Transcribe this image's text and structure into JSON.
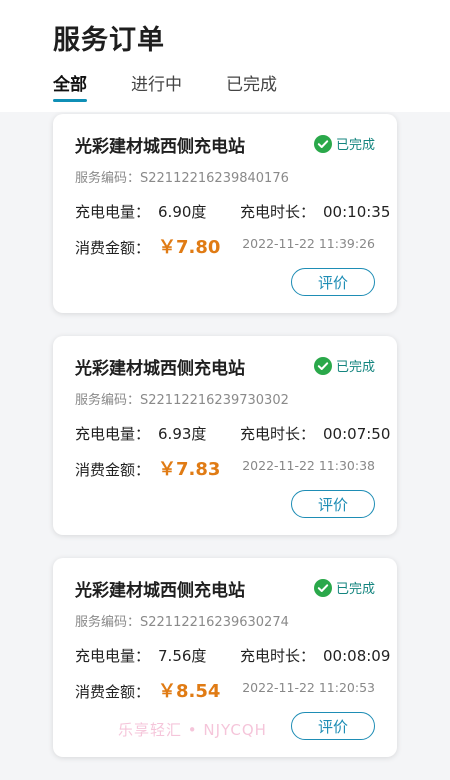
{
  "page": {
    "title": "服务订单"
  },
  "tabs": [
    {
      "label": "全部",
      "active": true
    },
    {
      "label": "进行中",
      "active": false
    },
    {
      "label": "已完成",
      "active": false
    }
  ],
  "colors": {
    "accent": "#0f8fb6",
    "amount": "#e07b14",
    "status": "#14857f"
  },
  "orders": [
    {
      "station": "光彩建材城西侧充电站",
      "status": "已完成",
      "code_label": "服务编码：",
      "code": "S22112216239840176",
      "energy_label": "充电电量：",
      "energy": "6.90度",
      "duration_label": "充电时长：",
      "duration": "00:10:35",
      "amount_label": "消费金额：",
      "amount": "￥7.80",
      "time": "2022-11-22 11:39:26",
      "review_label": "评价"
    },
    {
      "station": "光彩建材城西侧充电站",
      "status": "已完成",
      "code_label": "服务编码：",
      "code": "S22112216239730302",
      "energy_label": "充电电量：",
      "energy": "6.93度",
      "duration_label": "充电时长：",
      "duration": "00:07:50",
      "amount_label": "消费金额：",
      "amount": "￥7.83",
      "time": "2022-11-22 11:30:38",
      "review_label": "评价"
    },
    {
      "station": "光彩建材城西侧充电站",
      "status": "已完成",
      "code_label": "服务编码：",
      "code": "S22112216239630274",
      "energy_label": "充电电量：",
      "energy": "7.56度",
      "duration_label": "充电时长：",
      "duration": "00:08:09",
      "amount_label": "消费金额：",
      "amount": "￥8.54",
      "time": "2022-11-22 11:20:53",
      "review_label": "评价"
    }
  ],
  "watermark": "乐享轻汇 • NJYCQH"
}
